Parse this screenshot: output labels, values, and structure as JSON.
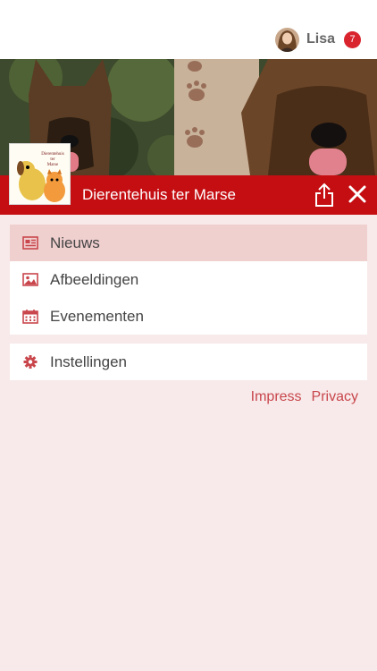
{
  "user": {
    "name": "Lisa",
    "badge_count": "7"
  },
  "header": {
    "title": "Dierentehuis ter Marse",
    "logo_text": "Dierentehuis ter Marse"
  },
  "menu": {
    "items": [
      {
        "label": "Nieuws",
        "icon": "newspaper-icon",
        "active": true
      },
      {
        "label": "Afbeeldingen",
        "icon": "image-icon",
        "active": false
      },
      {
        "label": "Evenementen",
        "icon": "calendar-icon",
        "active": false
      }
    ],
    "settings": {
      "label": "Instellingen",
      "icon": "gear-icon"
    }
  },
  "footer": {
    "impress": "Impress",
    "privacy": "Privacy"
  },
  "colors": {
    "brand_red": "#c40e12",
    "active_bg": "#f0cfcf",
    "page_bg": "#f8eaea",
    "badge": "#d9232d"
  }
}
